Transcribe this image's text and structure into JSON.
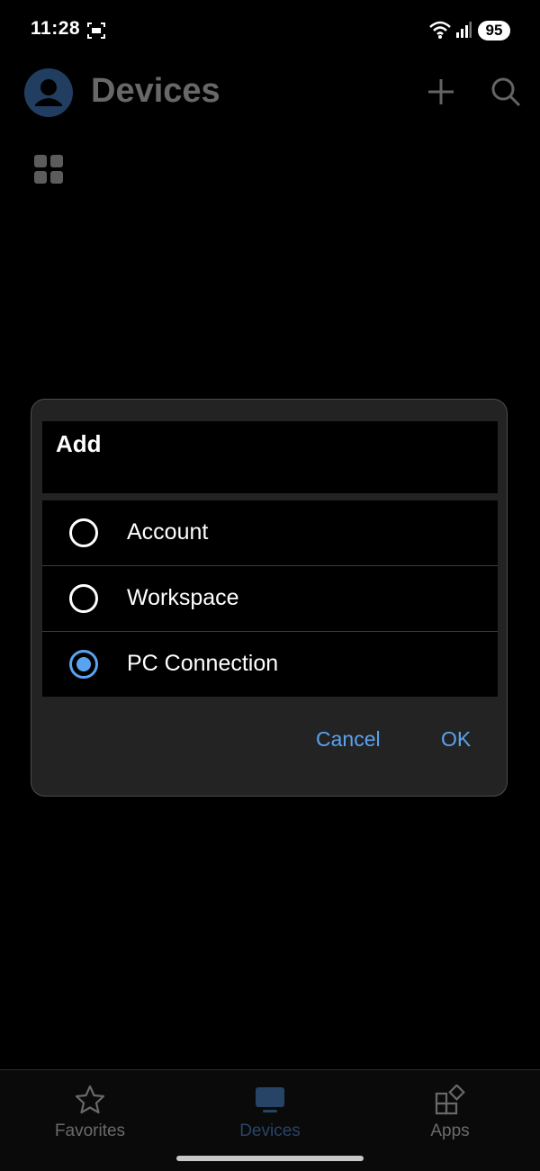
{
  "status_bar": {
    "time": "11:28",
    "battery": "95"
  },
  "app_bar": {
    "title": "Devices"
  },
  "dialog": {
    "title": "Add",
    "options": [
      {
        "label": "Account",
        "selected": false
      },
      {
        "label": "Workspace",
        "selected": false
      },
      {
        "label": "PC Connection",
        "selected": true
      }
    ],
    "cancel_label": "Cancel",
    "ok_label": "OK"
  },
  "bottom_nav": {
    "items": [
      {
        "label": "Favorites",
        "icon": "star-icon",
        "active": false
      },
      {
        "label": "Devices",
        "icon": "monitor-icon",
        "active": true
      },
      {
        "label": "Apps",
        "icon": "apps-icon",
        "active": false
      }
    ]
  },
  "colors": {
    "accent": "#5aa3f0",
    "avatar": "#4a8ad6",
    "dialog_bg": "#232323"
  }
}
